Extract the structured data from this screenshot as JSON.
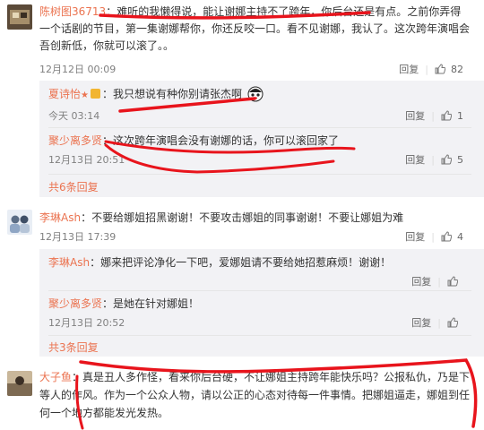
{
  "comments": [
    {
      "user": "陈树图36713",
      "text": "：难听的我懒得说，能让谢娜主持不了跨年，你后台还是有点。之前你弄得一个话剧的节目，第一集谢娜帮你，你还反咬一口。看不见谢娜，我认了。这次跨年演唱会吾创新低，你就可以滚了。。",
      "time": "12月12日 00:09",
      "reply_label": "回复",
      "likes": "82",
      "replies": [
        {
          "user": "夏诗怡",
          "text": "：我只想说有种你别请张杰啊",
          "time": "今天 03:14",
          "reply_label": "回复",
          "likes": "1"
        },
        {
          "user": "聚少离多贤",
          "text": "：这次跨年演唱会没有谢娜的话，你可以滚回家了",
          "time": "12月13日 20:51",
          "reply_label": "回复",
          "likes": "5"
        }
      ],
      "more": "共6条回复"
    },
    {
      "user": "李琳Ash",
      "text": "：不要给娜姐招黑谢谢！不要攻击娜姐的同事谢谢！不要让娜姐为难",
      "time": "12月13日 17:39",
      "reply_label": "回复",
      "likes": "4",
      "replies": [
        {
          "user": "李琳Ash",
          "text": "：娜来把评论净化一下吧，爱娜姐请不要给她招惹麻烦！谢谢！",
          "time": "",
          "reply_label": "回复",
          "likes": ""
        },
        {
          "user": "聚少离多贤",
          "text": "：是她在针对娜姐！",
          "time": "12月13日 20:52",
          "reply_label": "回复",
          "likes": ""
        }
      ],
      "more": "共3条回复"
    },
    {
      "user": "大子鱼",
      "text": "：真是丑人多作怪，看来你后台硬，不让娜姐主持跨年能快乐吗？公报私仇，乃是下等人的作风。作为一个公众人物，请以公正的心态对待每一件事情。把娜姐逼走，娜姐到任何一个地方都能发光发热。"
    }
  ],
  "colors": {
    "accent": "#eb7350",
    "annotation": "#e8141c"
  }
}
